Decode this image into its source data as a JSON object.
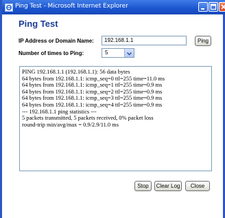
{
  "window": {
    "title": "Ping Test - Microsoft Internet Explorer"
  },
  "page": {
    "heading": "Ping Test",
    "address_label": "IP Address or Domain Name:",
    "address_value": "192.168.1.1",
    "ping_button": "Ping",
    "count_label": "Number of times to Ping:",
    "count_value": "5"
  },
  "log": {
    "lines": [
      "PING 192.168.1.1 (192.168.1.1): 56 data bytes",
      "64 bytes from 192.168.1.1: icmp_seq=0 ttl=255 time=11.0 ms",
      "64 bytes from 192.168.1.1: icmp_seq=1 ttl=255 time=0.9 ms",
      "64 bytes from 192.168.1.1: icmp_seq=2 ttl=255 time=0.9 ms",
      "64 bytes from 192.168.1.1: icmp_seq=3 ttl=255 time=0.9 ms",
      "64 bytes from 192.168.1.1: icmp_seq=4 ttl=255 time=0.9 ms",
      "--- 192.168.1.1 ping statistics ---",
      "5 packets transmitted, 5 packets received, 0% packet loss",
      "round-trip min/avg/max = 0.9/2.9/11.0 ms"
    ]
  },
  "buttons": {
    "stop": "Stop",
    "clear_log": "Clear Log",
    "close": "Close"
  }
}
